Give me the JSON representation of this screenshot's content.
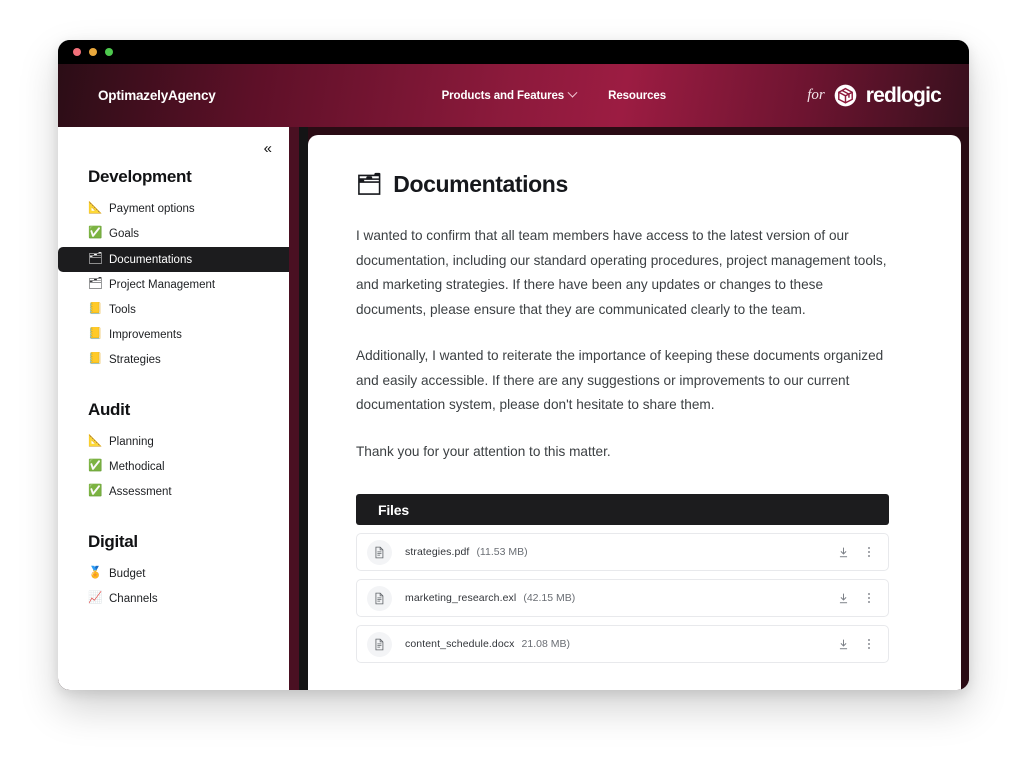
{
  "window": {
    "traffic_lights": [
      "close",
      "minimize",
      "maximize"
    ]
  },
  "header": {
    "brand": "OptimazelyAgency",
    "nav": [
      {
        "label": "Products and Features",
        "has_caret": true
      },
      {
        "label": "Resources",
        "has_caret": false
      }
    ],
    "logo_prefix": "for",
    "logo_word": "redlogic",
    "logo_icon": "cube-icon",
    "gradient_start": "#2b0d16",
    "gradient_mid": "#9c1c42",
    "gradient_end": "#37101d"
  },
  "sidebar": {
    "collapse_icon": "«",
    "groups": [
      {
        "title": "Development",
        "items": [
          {
            "icon": "📐",
            "icon_name": "triangular-ruler-icon",
            "label": "Payment options",
            "active": false
          },
          {
            "icon": "✅",
            "icon_name": "check-mark-icon",
            "label": "Goals",
            "active": false
          },
          {
            "icon": "🗂",
            "icon_name": "card-index-dividers-icon",
            "label": "Documentations",
            "active": true
          },
          {
            "icon": "🗂",
            "icon_name": "card-index-dividers-icon",
            "label": "Project Management",
            "active": false
          },
          {
            "icon": "📒",
            "icon_name": "ledger-icon",
            "label": "Tools",
            "active": false
          },
          {
            "icon": "📒",
            "icon_name": "ledger-icon",
            "label": "Improvements",
            "active": false
          },
          {
            "icon": "📒",
            "icon_name": "ledger-icon",
            "label": "Strategies",
            "active": false
          }
        ]
      },
      {
        "title": "Audit",
        "items": [
          {
            "icon": "📐",
            "icon_name": "triangular-ruler-icon",
            "label": "Planning",
            "active": false
          },
          {
            "icon": "✅",
            "icon_name": "check-mark-icon",
            "label": "Methodical",
            "active": false
          },
          {
            "icon": "✅",
            "icon_name": "check-mark-icon",
            "label": "Assessment",
            "active": false
          }
        ]
      },
      {
        "title": "Digital",
        "items": [
          {
            "icon": "🏅",
            "icon_name": "medal-icon",
            "label": "Budget",
            "active": false
          },
          {
            "icon": "📈",
            "icon_name": "chart-increasing-icon",
            "label": "Channels",
            "active": false
          }
        ]
      }
    ]
  },
  "main": {
    "title_icon": "🗂",
    "title": "Documentations",
    "paragraphs": [
      "I wanted to confirm that all team members have access to the latest version of our documentation, including our standard operating procedures, project management tools, and marketing strategies. If there have been any updates or changes to these documents, please ensure that they are communicated clearly to the team.",
      "Additionally, I wanted to reiterate the importance of keeping these documents organized and easily accessible. If there are any suggestions or improvements to our current documentation system, please don't hesitate to share them.",
      "Thank you for your attention to this matter."
    ],
    "files_section": {
      "header": "Files",
      "rows": [
        {
          "name": "strategies.pdf",
          "size": "(11.53 MB)"
        },
        {
          "name": "marketing_research.exl",
          "size": "(42.15 MB)"
        },
        {
          "name": "content_schedule.docx",
          "size": "21.08 MB)"
        }
      ],
      "download_icon": "download-icon",
      "more_icon": "more-options-icon"
    }
  }
}
